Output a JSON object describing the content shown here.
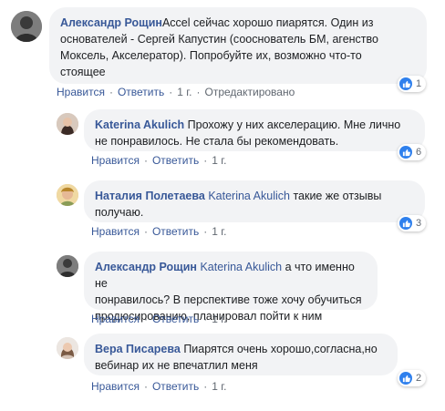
{
  "comments": [
    {
      "author": "Александр Рощин",
      "mention": "",
      "text_lines": [
        "Accel сейчас хорошо пиарятся. Один из",
        "основателей - Сергей Капустин (сооснователь БМ, агенство",
        "Моксель, Акселератор). Попробуйте их, возможно что-то",
        "стоящее"
      ],
      "like": "Нравится",
      "reply": "Ответить",
      "time": "1 г.",
      "edited": "Отредактировано",
      "reactions": "1"
    },
    {
      "author": "Katerina Akulich",
      "mention": "",
      "text_lines": [
        "Прохожу у них акселерацию. Мне лично",
        "не понравилось. Не стала бы рекомендовать."
      ],
      "like": "Нравится",
      "reply": "Ответить",
      "time": "1 г.",
      "reactions": "6"
    },
    {
      "author": "Наталия Полетаева",
      "mention": "Katerina Akulich",
      "text_lines": [
        "такие же отзывы",
        "получаю."
      ],
      "like": "Нравится",
      "reply": "Ответить",
      "time": "1 г.",
      "reactions": "3"
    },
    {
      "author": "Александр Рощин",
      "mention": "Katerina Akulich",
      "text_lines": [
        "а что именно не",
        "понравилось? В перспективе тоже хочу обучиться",
        "продюсированию, планировал пойти к ним"
      ],
      "like": "Нравится",
      "reply": "Ответить",
      "time": "1 г.",
      "reactions": ""
    },
    {
      "author": "Вера Писарева",
      "mention": "",
      "text_lines": [
        "Пиарятся очень хорошо,согласна,но",
        "вебинар их не впечатлил меня"
      ],
      "like": "Нравится",
      "reply": "Ответить",
      "time": "1 г.",
      "reactions": "2"
    }
  ],
  "colors": {
    "author": "#385898",
    "bubble": "#f2f3f5",
    "like_badge": "#2f80ed"
  },
  "icons": {
    "reaction": "thumbs-up-icon"
  }
}
